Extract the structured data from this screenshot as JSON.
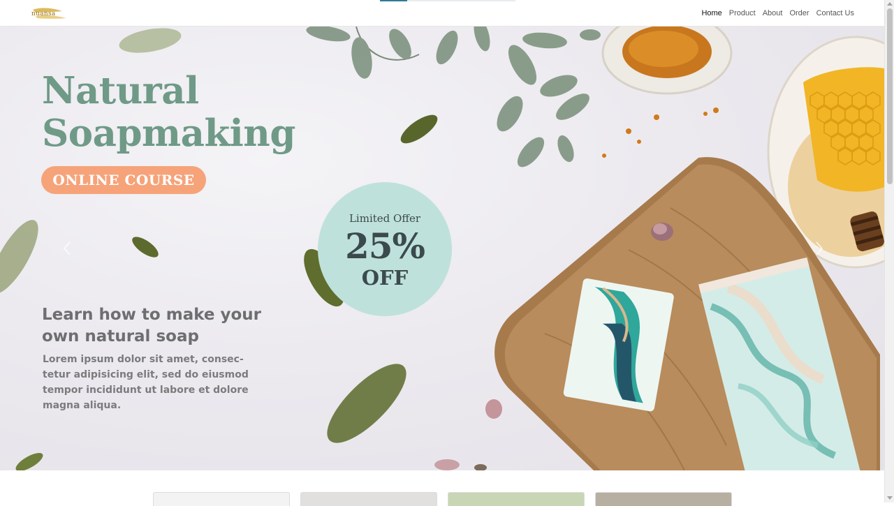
{
  "brand": {
    "logo_text": "nuansa",
    "logo_color": "#c9a227"
  },
  "nav": {
    "links": [
      "Home",
      "Product",
      "About",
      "Order",
      "Contact Us"
    ],
    "active_index": 0
  },
  "page_load_progress": 0.2,
  "hero": {
    "title": "Natural\nSoapmaking",
    "badge": "ONLINE COURSE",
    "offer": {
      "top": "Limited Offer",
      "percent": "25%",
      "bottom": "OFF"
    },
    "subtitle": "Learn how to make your own natural soap",
    "body": "Lorem ipsum dolor sit amet, consec-tetur adipisicing elit, sed do eiusmod tempor incididunt ut labore et dolore magna aliqua.",
    "controls": {
      "prev_icon": "chevron-left-icon",
      "next_icon": "chevron-right-icon"
    },
    "colors": {
      "title": "#6f9a87",
      "badge": "#f6a37a",
      "offer_circle": "#bfe1dc",
      "text": "#6e6e70"
    }
  },
  "product_cards": [
    {
      "color": "#f3f3f3"
    },
    {
      "color": "#e2e0de"
    },
    {
      "color": "#c8d6b5"
    },
    {
      "color": "#b8afa3"
    }
  ]
}
